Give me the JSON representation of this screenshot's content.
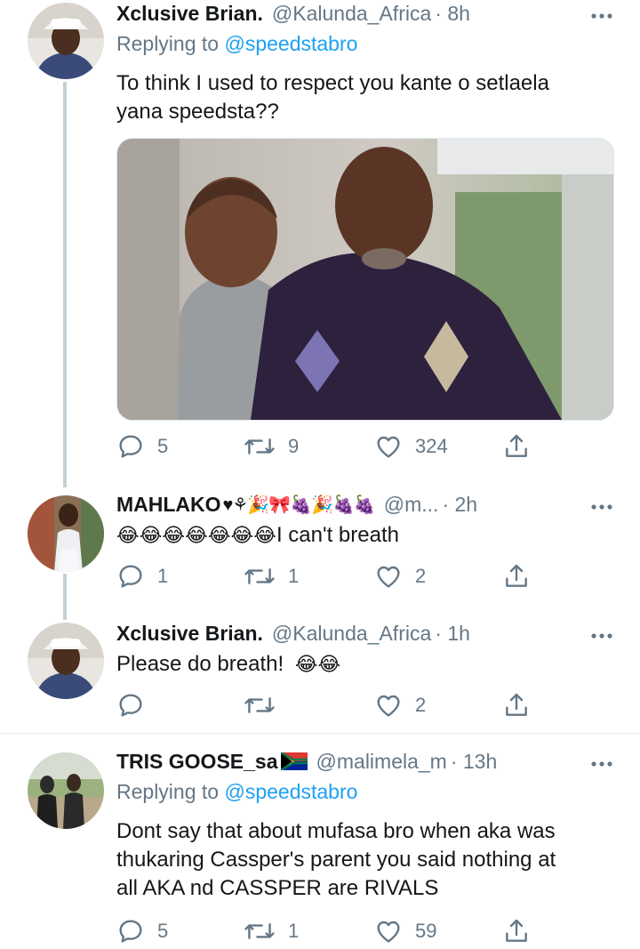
{
  "tweets": [
    {
      "name": "Xclusive Brian.",
      "handle": "@Kalunda_Africa",
      "time": "· 8h",
      "replying_prefix": "Replying to",
      "replying_to": "@speedstabro",
      "text": "To think I used to respect you kante o setlaela yana speedsta??",
      "stats": {
        "replies": "5",
        "retweets": "9",
        "likes": "324"
      }
    },
    {
      "name": "MAHLAKO",
      "name_emoji": "♥⚘🎉🎀🍇🎉🍇🍇",
      "handle": "@m...",
      "time": "· 2h",
      "emoji_run": "😂😂😂😂😂😂😂",
      "text": "I can't breath",
      "stats": {
        "replies": "1",
        "retweets": "1",
        "likes": "2"
      }
    },
    {
      "name": "Xclusive Brian.",
      "handle": "@Kalunda_Africa",
      "time": "· 1h",
      "text": "Please do breath!",
      "emoji_run": "😂😂",
      "stats": {
        "replies": "",
        "retweets": "",
        "likes": "2"
      }
    },
    {
      "name": "TRIS GOOSE_sa",
      "handle": "@malimela_m",
      "time": "· 13h",
      "replying_prefix": "Replying to",
      "replying_to": "@speedstabro",
      "text_lines": [
        "Dont say that about mufasa bro when aka was",
        "thukaring Cassper's parent you said nothing at",
        "all AKA nd  CASSPER are RIVALS"
      ],
      "stats": {
        "replies": "5",
        "retweets": "1",
        "likes": "59"
      }
    }
  ],
  "icons": {
    "reply": "reply-icon",
    "retweet": "retweet-icon",
    "like": "heart-icon",
    "share": "share-icon",
    "more": "more-icon"
  },
  "colors": {
    "text": "#14171a",
    "muted": "#657786",
    "link": "#1da1f2",
    "thread_line": "#c4cfd6",
    "divider": "#e1e8ed"
  }
}
